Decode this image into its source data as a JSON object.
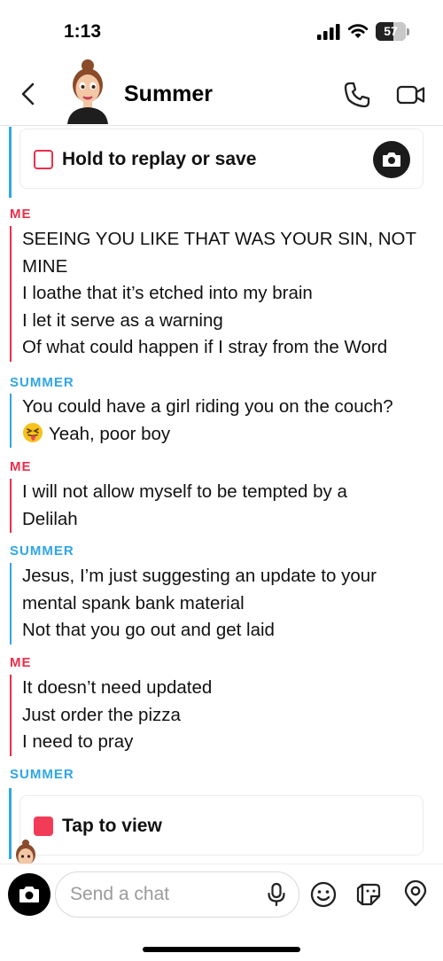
{
  "status_bar": {
    "time": "1:13",
    "battery": "57"
  },
  "header": {
    "title": "Summer",
    "icons": [
      "back-chevron-icon",
      "phone-icon",
      "video-camera-icon"
    ]
  },
  "chat": {
    "top_snap": {
      "label": "Hold to replay or save",
      "icon": "camera-icon"
    },
    "groups": [
      {
        "sender": "ME",
        "lines": [
          "SEEING YOU LIKE THAT WAS YOUR SIN, NOT",
          "MINE",
          "I loathe that it’s etched into my brain",
          "I let it serve as a warning",
          "Of what could happen if I stray from the Word"
        ]
      },
      {
        "sender": "SUMMER",
        "lines": [
          "You could have a girl riding you on the couch?",
          "Yeah, poor boy"
        ],
        "emoji": "squinting-face-with-tongue"
      },
      {
        "sender": "ME",
        "lines": [
          "I will not allow myself to be tempted by a",
          "Delilah"
        ]
      },
      {
        "sender": "SUMMER",
        "lines": [
          "Jesus, I’m just suggesting an update to your",
          "mental spank bank material",
          "Not that you go out and get laid"
        ]
      },
      {
        "sender": "ME",
        "lines": [
          "It doesn’t need updated",
          "Just order the pizza",
          "I need to pray"
        ]
      },
      {
        "sender": "SUMMER",
        "lines": []
      }
    ],
    "bottom_snap": {
      "label": "Tap to view"
    }
  },
  "composer": {
    "placeholder": "Send a chat",
    "icons": [
      "camera-icon",
      "microphone-icon",
      "smiley-icon",
      "sticker-icon",
      "location-pin-icon"
    ]
  },
  "colors": {
    "me": "#e8304b",
    "them": "#2fa6e6",
    "snap_unopened": "#f23c57"
  }
}
